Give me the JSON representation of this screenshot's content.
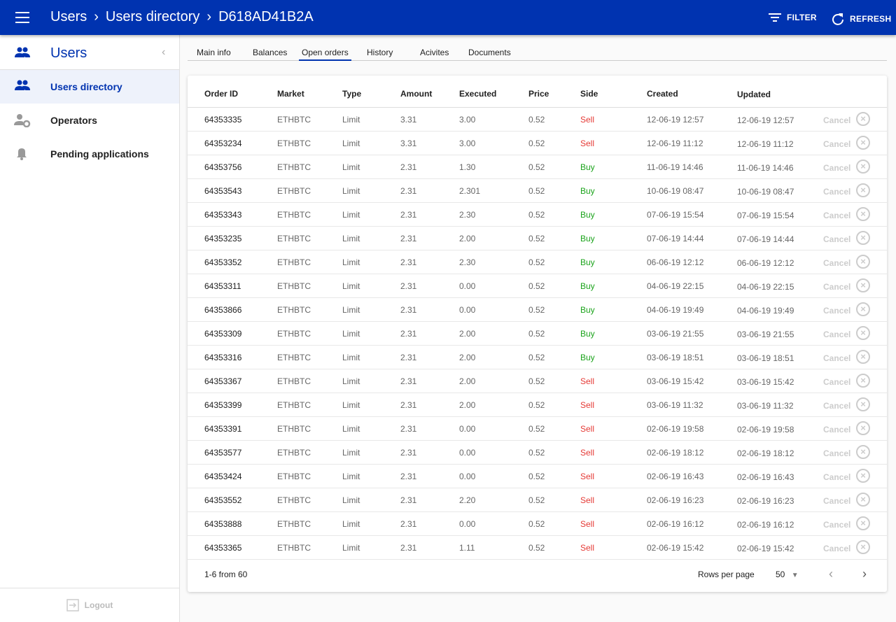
{
  "header": {
    "breadcrumb": [
      "Users",
      "Users directory",
      "D618AD41B2A"
    ],
    "filter_label": "FILTER",
    "refresh_label": "REFRESH",
    "accent": "#0033b0"
  },
  "sidebar": {
    "title": "Users",
    "items": [
      {
        "label": "Users directory",
        "icon": "people-icon",
        "active": true
      },
      {
        "label": "Operators",
        "icon": "user-settings-icon"
      },
      {
        "label": "Pending applications",
        "icon": "bell-icon"
      }
    ],
    "logout_label": "Logout"
  },
  "tabs": [
    "Main info",
    "Balances",
    "Open orders",
    "History",
    "Acivites",
    "Documents"
  ],
  "active_tab": "Open orders",
  "table": {
    "columns": [
      "Order ID",
      "Market",
      "Type",
      "Amount",
      "Executed",
      "Price",
      "Side",
      "Created",
      "Updated"
    ],
    "cancel_label": "Cancel",
    "rows": [
      [
        "64353335",
        "ETHBTC",
        "Limit",
        "3.31",
        "3.00",
        "0.52",
        "Sell",
        "12-06-19 12:57",
        "12-06-19 12:57"
      ],
      [
        "64353234",
        "ETHBTC",
        "Limit",
        "3.31",
        "3.00",
        "0.52",
        "Sell",
        "12-06-19 11:12",
        "12-06-19 11:12"
      ],
      [
        "64353756",
        "ETHBTC",
        "Limit",
        "2.31",
        "1.30",
        "0.52",
        "Buy",
        "11-06-19 14:46",
        "11-06-19 14:46"
      ],
      [
        "64353543",
        "ETHBTC",
        "Limit",
        "2.31",
        "2.301",
        "0.52",
        "Buy",
        "10-06-19 08:47",
        "10-06-19 08:47"
      ],
      [
        "64353343",
        "ETHBTC",
        "Limit",
        "2.31",
        "2.30",
        "0.52",
        "Buy",
        "07-06-19 15:54",
        "07-06-19 15:54"
      ],
      [
        "64353235",
        "ETHBTC",
        "Limit",
        "2.31",
        "2.00",
        "0.52",
        "Buy",
        "07-06-19 14:44",
        "07-06-19 14:44"
      ],
      [
        "64353352",
        "ETHBTC",
        "Limit",
        "2.31",
        "2.30",
        "0.52",
        "Buy",
        "06-06-19 12:12",
        "06-06-19 12:12"
      ],
      [
        "64353311",
        "ETHBTC",
        "Limit",
        "2.31",
        "0.00",
        "0.52",
        "Buy",
        "04-06-19 22:15",
        "04-06-19 22:15"
      ],
      [
        "64353866",
        "ETHBTC",
        "Limit",
        "2.31",
        "0.00",
        "0.52",
        "Buy",
        "04-06-19 19:49",
        "04-06-19 19:49"
      ],
      [
        "64353309",
        "ETHBTC",
        "Limit",
        "2.31",
        "2.00",
        "0.52",
        "Buy",
        "03-06-19 21:55",
        "03-06-19 21:55"
      ],
      [
        "64353316",
        "ETHBTC",
        "Limit",
        "2.31",
        "2.00",
        "0.52",
        "Buy",
        "03-06-19 18:51",
        "03-06-19 18:51"
      ],
      [
        "64353367",
        "ETHBTC",
        "Limit",
        "2.31",
        "2.00",
        "0.52",
        "Sell",
        "03-06-19 15:42",
        "03-06-19 15:42"
      ],
      [
        "64353399",
        "ETHBTC",
        "Limit",
        "2.31",
        "2.00",
        "0.52",
        "Sell",
        "03-06-19 11:32",
        "03-06-19 11:32"
      ],
      [
        "64353391",
        "ETHBTC",
        "Limit",
        "2.31",
        "0.00",
        "0.52",
        "Sell",
        "02-06-19 19:58",
        "02-06-19 19:58"
      ],
      [
        "64353577",
        "ETHBTC",
        "Limit",
        "2.31",
        "0.00",
        "0.52",
        "Sell",
        "02-06-19 18:12",
        "02-06-19 18:12"
      ],
      [
        "64353424",
        "ETHBTC",
        "Limit",
        "2.31",
        "0.00",
        "0.52",
        "Sell",
        "02-06-19 16:43",
        "02-06-19 16:43"
      ],
      [
        "64353552",
        "ETHBTC",
        "Limit",
        "2.31",
        "2.20",
        "0.52",
        "Sell",
        "02-06-19 16:23",
        "02-06-19 16:23"
      ],
      [
        "64353888",
        "ETHBTC",
        "Limit",
        "2.31",
        "0.00",
        "0.52",
        "Sell",
        "02-06-19 16:12",
        "02-06-19 16:12"
      ],
      [
        "64353365",
        "ETHBTC",
        "Limit",
        "2.31",
        "1.11",
        "0.52",
        "Sell",
        "02-06-19 15:42",
        "02-06-19 15:42"
      ]
    ]
  },
  "pagination": {
    "range_text": "1-6 from 60",
    "rows_per_page_label": "Rows per page",
    "rows_per_page": "50"
  }
}
